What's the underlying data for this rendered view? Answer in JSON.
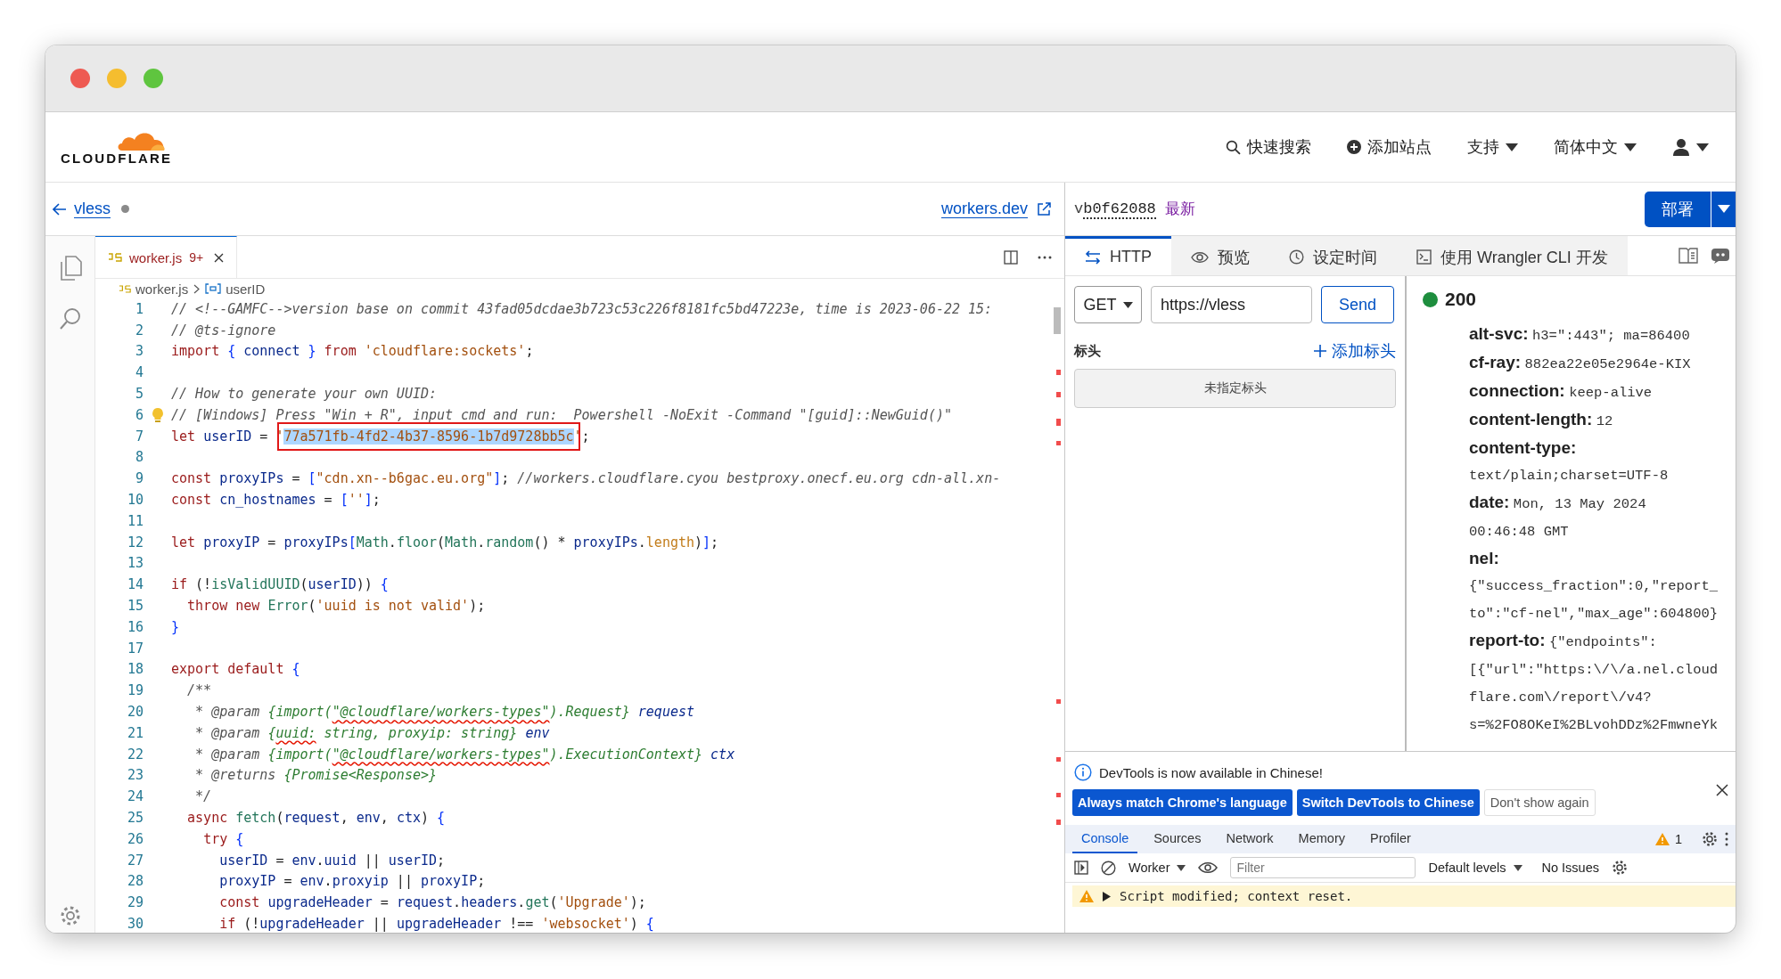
{
  "window": {
    "controls": [
      {
        "kind": "close"
      },
      {
        "kind": "minimize"
      },
      {
        "kind": "maximize"
      }
    ]
  },
  "header": {
    "logo": "CLOUDFLARE",
    "nav": [
      {
        "label": "快速搜索",
        "kind": "search"
      },
      {
        "label": "添加站点",
        "kind": "add"
      },
      {
        "label": "支持",
        "kind": "menu"
      },
      {
        "label": "简体中文",
        "kind": "menu"
      },
      {
        "kind": "user"
      }
    ]
  },
  "worker": {
    "back_label": "vless",
    "unsaved": true,
    "preview_link": "workers.dev"
  },
  "editor": {
    "tabs": [
      {
        "label": "worker.js",
        "badge": "9+",
        "selected": true
      }
    ],
    "breadcrumb": [
      {
        "label": "worker.js",
        "kind": "file"
      },
      {
        "label": "userID",
        "kind": "variable"
      }
    ],
    "lines": [
      {
        "n": "1",
        "segments": [
          {
            "text": "// <!--GAMFC-->version base on commit 43fad05dcdae3b723c53c226f8181fc5bd47223e, time is 2023-06-22 15:",
            "kind": "code"
          }
        ]
      },
      {
        "n": "2",
        "segments": [
          {
            "text": "// @ts-ignore",
            "kind": "code"
          }
        ]
      },
      {
        "n": "3",
        "segments": [
          {
            "text": "import { connect } from 'cloudflare:sockets';",
            "kind": "code"
          }
        ]
      },
      {
        "n": "4"
      },
      {
        "n": "5",
        "segments": [
          {
            "text": "// How to generate your own UUID:",
            "kind": "code"
          }
        ]
      },
      {
        "n": "6",
        "segments": [
          {
            "text": "// [Windows] Press \"Win + R\", input cmd and run:  Powershell -NoExit -Command \"[guid]::NewGuid()\"",
            "kind": "hint"
          }
        ]
      },
      {
        "n": "7",
        "segments": [
          {
            "text": "let userID = '",
            "kind": "code"
          },
          {
            "text": "77a571fb-4fd2-4b37-8596-1b7d9728bb5c",
            "kind": "selected"
          },
          {
            "text": "';",
            "kind": "code"
          }
        ]
      },
      {
        "n": "8"
      },
      {
        "n": "9",
        "segments": [
          {
            "text": "const proxyIPs = [\"cdn.xn--b6gac.eu.org\"]; //workers.cloudflare.cyou bestproxy.onecf.eu.org cdn-all.xn-",
            "kind": "code"
          }
        ]
      },
      {
        "n": "10",
        "segments": [
          {
            "text": "const cn_hostnames = [''];",
            "kind": "code"
          }
        ]
      },
      {
        "n": "11"
      },
      {
        "n": "12",
        "segments": [
          {
            "text": "let proxyIP = proxyIPs[Math.floor(Math.random() * proxyIPs.length)];",
            "kind": "code"
          }
        ]
      },
      {
        "n": "13"
      },
      {
        "n": "14",
        "segments": [
          {
            "text": "if (!isValidUUID(userID)) {",
            "kind": "code"
          }
        ]
      },
      {
        "n": "15",
        "segments": [
          {
            "text": "  throw new Error('uuid is not valid');",
            "kind": "code"
          }
        ]
      },
      {
        "n": "16",
        "segments": [
          {
            "text": "}",
            "kind": "code"
          }
        ]
      },
      {
        "n": "17"
      },
      {
        "n": "18",
        "segments": [
          {
            "text": "export default {",
            "kind": "code"
          }
        ]
      },
      {
        "n": "19",
        "segments": [
          {
            "text": "  /**",
            "kind": "code"
          }
        ]
      },
      {
        "n": "20",
        "segments": [
          {
            "text": "   * @param {import(",
            "kind": "code"
          },
          {
            "text": "\"@cloudflare/workers-types\"",
            "kind": "error"
          },
          {
            "text": ").Request} request",
            "kind": "code"
          }
        ]
      },
      {
        "n": "21",
        "segments": [
          {
            "text": "   * @param {",
            "kind": "code"
          },
          {
            "text": "uuid:",
            "kind": "error"
          },
          {
            "text": " string, proxyip: string} env",
            "kind": "code"
          }
        ]
      },
      {
        "n": "22",
        "segments": [
          {
            "text": "   * @param {import(",
            "kind": "code"
          },
          {
            "text": "\"@cloudflare/workers-types\"",
            "kind": "error"
          },
          {
            "text": ").ExecutionContext} ctx",
            "kind": "code"
          }
        ]
      },
      {
        "n": "23",
        "segments": [
          {
            "text": "   * @returns {Promise<Response>}",
            "kind": "code"
          }
        ]
      },
      {
        "n": "24",
        "segments": [
          {
            "text": "   */",
            "kind": "code"
          }
        ]
      },
      {
        "n": "25",
        "segments": [
          {
            "text": "  async fetch(request, env, ctx) {",
            "kind": "code"
          }
        ]
      },
      {
        "n": "26",
        "segments": [
          {
            "text": "    try {",
            "kind": "code"
          }
        ]
      },
      {
        "n": "27",
        "segments": [
          {
            "text": "      userID = env.uuid || userID;",
            "kind": "code"
          }
        ]
      },
      {
        "n": "28",
        "segments": [
          {
            "text": "      proxyIP = env.proxyip || proxyIP;",
            "kind": "code"
          }
        ]
      },
      {
        "n": "29",
        "segments": [
          {
            "text": "      const upgradeHeader = request.headers.get('Upgrade');",
            "kind": "code"
          }
        ]
      },
      {
        "n": "30",
        "segments": [
          {
            "text": "      if (!upgradeHeader || upgradeHeader !== 'websocket') {",
            "kind": "code"
          }
        ]
      }
    ]
  },
  "version": {
    "prefix": "v",
    "hash": "b0f62088",
    "tag": "最新"
  },
  "deploy_label": "部署",
  "preview_tabs": [
    {
      "label": "HTTP",
      "kind": "http",
      "selected": true
    },
    {
      "label": "预览",
      "kind": "preview",
      "selected": false
    },
    {
      "label": "设定时间",
      "kind": "schedule",
      "selected": false
    },
    {
      "label": "使用 Wrangler CLI 开发",
      "kind": "terminal",
      "selected": false
    }
  ],
  "request": {
    "method": "GET",
    "url": "https://vless",
    "send": "Send",
    "headers_label": "标头",
    "add_header": "添加标头",
    "empty_headers": "未指定标头"
  },
  "response": {
    "status": "200",
    "headers": [
      {
        "name": "alt-svc:",
        "value": "h3=\":443\"; ma=86400"
      },
      {
        "name": "cf-ray:",
        "value": "882ea22e05e2964e-KIX"
      },
      {
        "name": "connection:",
        "value": "keep-alive"
      },
      {
        "name": "content-length:",
        "value": "12"
      },
      {
        "name": "content-type:",
        "value": "text/plain;charset=UTF-8"
      },
      {
        "name": "date:",
        "value": "Mon, 13 May 2024 00:46:48 GMT"
      },
      {
        "name": "nel:",
        "value": "{\"success_fraction\":0,\"report_to\":\"cf-nel\",\"max_age\":604800}"
      },
      {
        "name": "report-to:",
        "value": "{\"endpoints\":[{\"url\":\"https:\\/\\/a.nel.cloudflare.com\\/report\\/v4?s=%2FO8OKeI%2BLvohDDz%2FmwneYk"
      }
    ]
  },
  "devtools": {
    "notice": "DevTools is now available in Chinese!",
    "buttons": [
      {
        "label": "Always match Chrome's language",
        "kind": "primary"
      },
      {
        "label": "Switch DevTools to Chinese",
        "kind": "primary"
      },
      {
        "label": "Don't show again",
        "kind": "secondary"
      }
    ],
    "tabs": [
      {
        "label": "Console",
        "selected": true
      },
      {
        "label": "Sources",
        "selected": false
      },
      {
        "label": "Network",
        "selected": false
      },
      {
        "label": "Memory",
        "selected": false
      },
      {
        "label": "Profiler",
        "selected": false
      }
    ],
    "warnings": "1",
    "context": "Worker",
    "filter_placeholder": "Filter",
    "levels": "Default levels",
    "issues": "No Issues",
    "messages": [
      {
        "kind": "warning",
        "text": "Script modified; context reset."
      }
    ]
  }
}
